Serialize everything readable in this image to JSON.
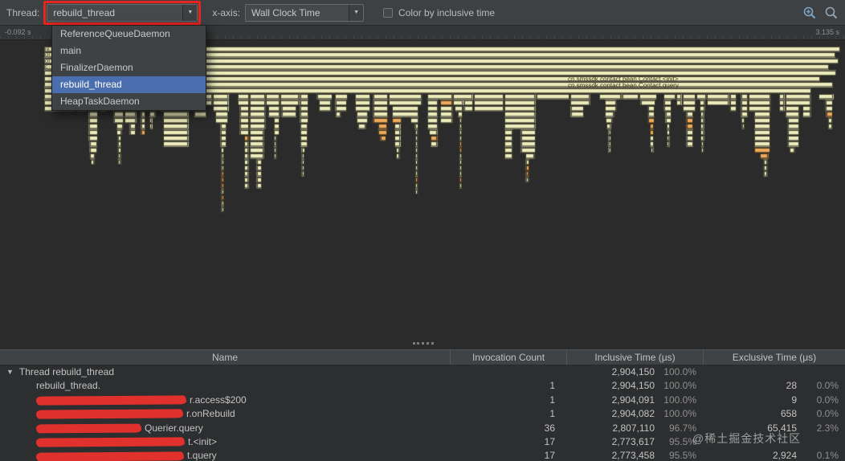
{
  "toolbar": {
    "thread_label": "Thread:",
    "thread_value": "rebuild_thread",
    "xaxis_label": "x-axis:",
    "xaxis_value": "Wall Clock Time",
    "checkbox_label": "Color by inclusive time",
    "checkbox_checked": false,
    "dropdown_arrow": "▼"
  },
  "thread_dropdown": {
    "items": [
      {
        "label": "ReferenceQueueDaemon",
        "selected": false
      },
      {
        "label": "main",
        "selected": false
      },
      {
        "label": "FinalizerDaemon",
        "selected": false
      },
      {
        "label": "rebuild_thread",
        "selected": true
      },
      {
        "label": "HeapTaskDaemon",
        "selected": false
      }
    ]
  },
  "ruler": {
    "start": "-0.092 s",
    "end": "3.135 s"
  },
  "flame": {
    "bar_labels": [
      "cn.smssdk.contact.bean.Contact.<init>",
      "cn.smssdk.contact.bean.Contact.query"
    ],
    "left_clipped_labels": [
      "re",
      "cn",
      "cn",
      "c"
    ],
    "colors": {
      "bar": "#ecebbc",
      "accent": "#eda95c",
      "outline": "#20200f",
      "bg": "#2b2b2b"
    }
  },
  "icons": {
    "zoom_to_selection": "magnifier-plus-icon",
    "search": "magnifier-icon",
    "combo_arrow": "chevron-down-icon",
    "annotation_color": "#e8241f"
  },
  "table": {
    "columns": [
      "Name",
      "Invocation Count",
      "Inclusive Time (μs)",
      "Exclusive Time (μs)"
    ],
    "rows": [
      {
        "expander": "▼",
        "name": "Thread rebuild_thread",
        "count": "",
        "inclusive": "2,904,150",
        "inclusive_pct": "100.0%",
        "exclusive": "",
        "exclusive_pct": "",
        "redacted": false
      },
      {
        "name": "rebuild_thread.",
        "count": "1",
        "inclusive": "2,904,150",
        "inclusive_pct": "100.0%",
        "exclusive": "28",
        "exclusive_pct": "0.0%",
        "redacted": false
      },
      {
        "name_tail": "r.access$200",
        "count": "1",
        "inclusive": "2,904,091",
        "inclusive_pct": "100.0%",
        "exclusive": "9",
        "exclusive_pct": "0.0%",
        "redacted": true
      },
      {
        "name_tail": "r.onRebuild",
        "count": "1",
        "inclusive": "2,904,082",
        "inclusive_pct": "100.0%",
        "exclusive": "658",
        "exclusive_pct": "0.0%",
        "redacted": true
      },
      {
        "name_tail": "Querier.query",
        "count": "36",
        "inclusive": "2,807,110",
        "inclusive_pct": "96.7%",
        "exclusive": "65,415",
        "exclusive_pct": "2.3%",
        "redacted": true
      },
      {
        "name_tail": "t.<init>",
        "count": "17",
        "inclusive": "2,773,617",
        "inclusive_pct": "95.5%",
        "exclusive": "",
        "exclusive_pct": "",
        "redacted": true
      },
      {
        "name_tail": "t.query",
        "count": "17",
        "inclusive": "2,773,458",
        "inclusive_pct": "95.5%",
        "exclusive": "2,924",
        "exclusive_pct": "0.1%",
        "redacted": true
      }
    ]
  },
  "watermark": "@稀土掘金技术社区"
}
